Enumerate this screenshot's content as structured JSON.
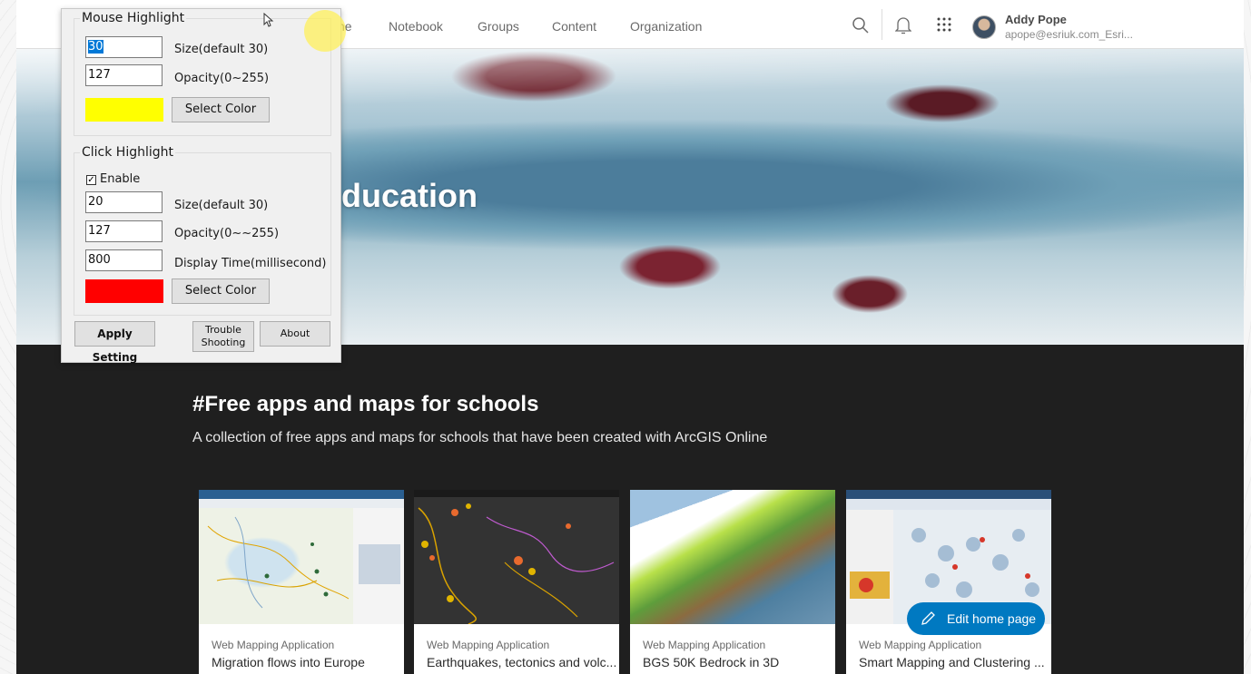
{
  "nav": {
    "items": [
      "Notebook",
      "Groups",
      "Content",
      "Organization"
    ],
    "partial_item": "ne"
  },
  "user": {
    "name": "Addy Pope",
    "email": "apope@esriuk.com_Esri..."
  },
  "hero": {
    "title": "ducation"
  },
  "section": {
    "title": "#Free apps and maps for schools",
    "description": "A collection of free apps and maps for schools that have been created with ArcGIS Online"
  },
  "cards": [
    {
      "type": "Web Mapping Application",
      "title": "Migration flows into Europe"
    },
    {
      "type": "Web Mapping Application",
      "title": "Earthquakes, tectonics and volc..."
    },
    {
      "type": "Web Mapping Application",
      "title": "BGS 50K Bedrock in 3D"
    },
    {
      "type": "Web Mapping Application",
      "title": "Smart Mapping and Clustering ..."
    }
  ],
  "edit_button": {
    "label": "Edit home page"
  },
  "dialog": {
    "mouse": {
      "title": "Mouse Highlight",
      "size_value": "30",
      "size_label": "Size(default 30)",
      "opacity_value": "127",
      "opacity_label": "Opacity(0~255)",
      "color": "#ffff00",
      "select_color_label": "Select Color"
    },
    "click": {
      "title": "Click Highlight",
      "enable_label": "Enable",
      "enabled": true,
      "size_value": "20",
      "size_label": "Size(default 30)",
      "opacity_value": "127",
      "opacity_label": "Opacity(0~~255)",
      "time_value": "800",
      "time_label": "Display Time(millisecond)",
      "color": "#ff0000",
      "select_color_label": "Select Color"
    },
    "apply_label": "Apply Setting",
    "trouble_label_1": "Trouble",
    "trouble_label_2": "Shooting",
    "about_label": "About"
  },
  "colors": {
    "accent": "#0079c1",
    "dark_section": "#1f1f1f"
  }
}
